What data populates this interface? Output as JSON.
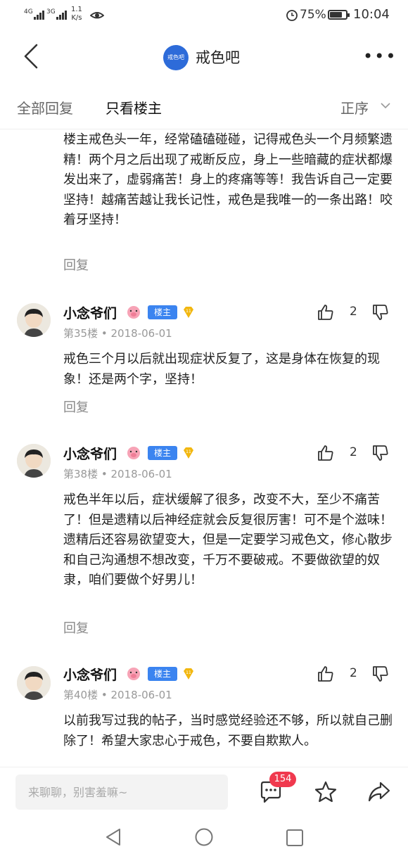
{
  "status_bar": {
    "signal_1": "4G",
    "signal_2": "3G",
    "net_speed_value": "1.1",
    "net_speed_unit": "K/s",
    "battery_percent": "75%",
    "battery_level": 0.75,
    "time": "10:04"
  },
  "nav": {
    "forum_logo_text": "戒色吧",
    "forum_name": "戒色吧"
  },
  "tabs": {
    "all_replies": "全部回复",
    "host_only": "只看楼主",
    "sort": "正序"
  },
  "feed": {
    "top_post": {
      "text": "楼主戒色头一年，经常磕磕碰碰，记得戒色头一个月频繁遗精！两个月之后出现了戒断反应，身上一些暗藏的症状都爆发出来了，虚弱痛苦！身上的疼痛等等！我告诉自己一定要坚持！越痛苦越让我长记性，戒色是我唯一的一条出路！咬着牙坚持！",
      "reply_label": "回复"
    },
    "posts": [
      {
        "username": "小念爷们",
        "host_badge": "楼主",
        "level": "11",
        "floor": "第35楼",
        "date": "2018-06-01",
        "likes": "2",
        "text": "戒色三个月以后就出现症状反复了，这是身体在恢复的现象！还是两个字，坚持！",
        "reply_label": "回复"
      },
      {
        "username": "小念爷们",
        "host_badge": "楼主",
        "level": "11",
        "floor": "第38楼",
        "date": "2018-06-01",
        "likes": "2",
        "text": "戒色半年以后，症状缓解了很多，改变不大，至少不痛苦了！但是遗精以后神经症就会反复很厉害！可不是个滋味！遗精后还容易欲望变大，但是一定要学习戒色文，修心散步和自己沟通想不想改变，千万不要破戒。不要做欲望的奴隶，咱们要做个好男儿！",
        "reply_label": "回复"
      },
      {
        "username": "小念爷们",
        "host_badge": "楼主",
        "level": "11",
        "floor": "第40楼",
        "date": "2018-06-01",
        "likes": "2",
        "text": "以前我写过我的帖子，当时感觉经验还不够，所以就自己删除了！希望大家忠心于戒色，不要自欺欺人。",
        "reply_label": "回复"
      }
    ],
    "meta_separator": "•"
  },
  "bottom_bar": {
    "input_placeholder": "来聊聊，别害羞嘛~",
    "comment_count": "154"
  },
  "colors": {
    "accent_blue": "#3b84f0",
    "badge_red": "#f0394e",
    "level_gold": "#f2b70f"
  }
}
